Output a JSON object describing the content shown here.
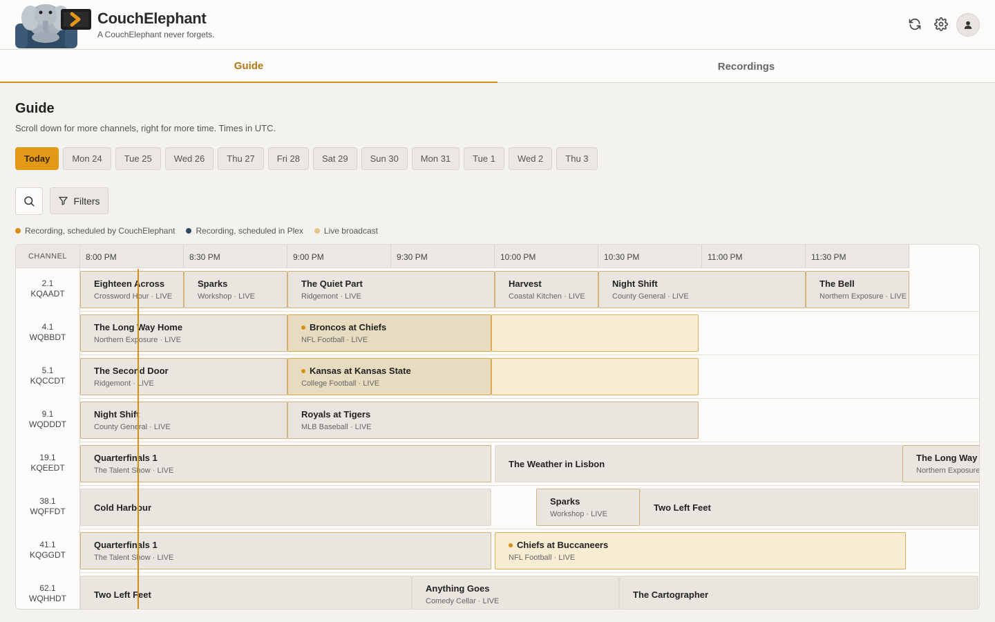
{
  "app": {
    "name": "CouchElephant",
    "tagline": "A CouchElephant never forgets."
  },
  "header_icons": [
    "refresh-icon",
    "gear-icon",
    "user-icon"
  ],
  "tabs": [
    {
      "label": "Guide",
      "active": true
    },
    {
      "label": "Recordings",
      "active": false
    }
  ],
  "page": {
    "title": "Guide",
    "subtitle": "Scroll down for more channels, right for more time. Times in UTC."
  },
  "days": [
    "Today",
    "Mon 24",
    "Tue 25",
    "Wed 26",
    "Thu 27",
    "Fri 28",
    "Sat 29",
    "Sun 30",
    "Mon 31",
    "Tue 1",
    "Wed 2",
    "Thu 3"
  ],
  "filters_label": "Filters",
  "legend": [
    {
      "label": "Recording, scheduled by CouchElephant",
      "color": "#d68f12"
    },
    {
      "label": "Recording, scheduled in Plex",
      "color": "#2f4a64"
    },
    {
      "label": "Live broadcast",
      "color": "#e6c48a"
    }
  ],
  "grid": {
    "channel_header": "CHANNEL",
    "times": [
      "8:00 PM",
      "8:30 PM",
      "9:00 PM",
      "9:30 PM",
      "10:00 PM",
      "10:30 PM",
      "11:00 PM",
      "11:30 PM"
    ],
    "rows": [
      {
        "number": "2.1",
        "callsign": "KQAADT",
        "programs": [
          {
            "title": "Eighteen Across",
            "sub": "Crossword Hour · LIVE",
            "start": 0,
            "end": 30
          },
          {
            "title": "Sparks",
            "sub": "Workshop · LIVE",
            "start": 30,
            "end": 60
          },
          {
            "title": "The Quiet Part",
            "sub": "Ridgemont · LIVE",
            "start": 60,
            "end": 120
          },
          {
            "title": "Harvest",
            "sub": "Coastal Kitchen · LIVE",
            "start": 120,
            "end": 150
          },
          {
            "title": "Night Shift",
            "sub": "County General · LIVE",
            "start": 150,
            "end": 210
          },
          {
            "title": "The Bell",
            "sub": "Northern Exposure · LIVE",
            "start": 210,
            "end": 240
          }
        ]
      },
      {
        "number": "4.1",
        "callsign": "WQBBDT",
        "programs": [
          {
            "title": "The Long Way Home",
            "sub": "Northern Exposure · LIVE",
            "start": 0,
            "end": 60
          },
          {
            "title": "Broncos at Chiefs",
            "sub": "NFL Football · LIVE",
            "start": 60,
            "end": 119,
            "state": "rec"
          },
          {
            "title": "",
            "sub": "",
            "start": 119,
            "end": 179,
            "state": "live"
          }
        ]
      },
      {
        "number": "5.1",
        "callsign": "KQCCDT",
        "programs": [
          {
            "title": "The Second Door",
            "sub": "Ridgemont · LIVE",
            "start": 0,
            "end": 60
          },
          {
            "title": "Kansas at Kansas State",
            "sub": "College Football · LIVE",
            "start": 60,
            "end": 119,
            "state": "rec"
          },
          {
            "title": "",
            "sub": "",
            "start": 119,
            "end": 179,
            "state": "live"
          }
        ]
      },
      {
        "number": "9.1",
        "callsign": "WQDDDT",
        "programs": [
          {
            "title": "Night Shift",
            "sub": "County General · LIVE",
            "start": 0,
            "end": 60
          },
          {
            "title": "Royals at Tigers",
            "sub": "MLB Baseball · LIVE",
            "start": 60,
            "end": 179
          }
        ]
      },
      {
        "number": "19.1",
        "callsign": "KQEEDT",
        "programs": [
          {
            "title": "Quarterfinals 1",
            "sub": "The Talent Show · LIVE",
            "start": 0,
            "end": 119
          },
          {
            "title": "The Weather in Lisbon",
            "sub": "",
            "start": 120,
            "end": 238,
            "state": "grey"
          },
          {
            "title": "The Long Way Home",
            "sub": "Northern Exposure · LIVE",
            "start": 238,
            "end": 270
          }
        ]
      },
      {
        "number": "38.1",
        "callsign": "WQFFDT",
        "programs": [
          {
            "title": "Cold Harbour",
            "sub": "",
            "start": 0,
            "end": 119,
            "state": "grey"
          },
          {
            "title": "Sparks",
            "sub": "Workshop · LIVE",
            "start": 132,
            "end": 162
          },
          {
            "title": "Two Left Feet",
            "sub": "",
            "start": 162,
            "end": 260,
            "state": "grey"
          }
        ]
      },
      {
        "number": "41.1",
        "callsign": "KQGGDT",
        "programs": [
          {
            "title": "Quarterfinals 1",
            "sub": "The Talent Show · LIVE",
            "start": 0,
            "end": 119
          },
          {
            "title": "Chiefs at Buccaneers",
            "sub": "NFL Football · LIVE",
            "start": 120,
            "end": 239,
            "state": "live-rec"
          }
        ]
      },
      {
        "number": "62.1",
        "callsign": "WQHHDT",
        "programs": [
          {
            "title": "Two Left Feet",
            "sub": "",
            "start": 0,
            "end": 96,
            "state": "grey"
          },
          {
            "title": "Anything Goes",
            "sub": "Comedy Cellar · LIVE",
            "start": 96,
            "end": 156,
            "state": "grey"
          },
          {
            "title": "The Cartographer",
            "sub": "",
            "start": 156,
            "end": 260,
            "state": "grey"
          }
        ]
      }
    ]
  }
}
